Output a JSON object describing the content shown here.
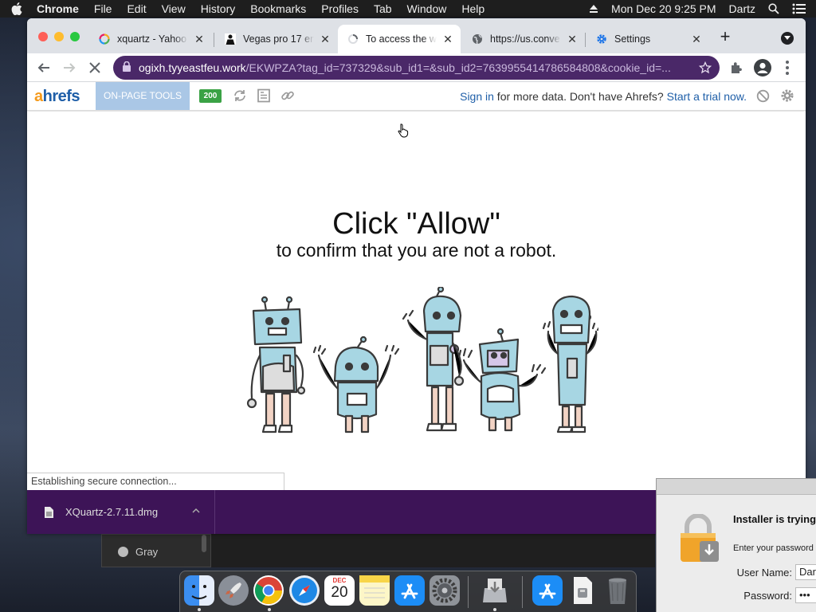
{
  "menubar": {
    "app_name": "Chrome",
    "items": [
      "File",
      "Edit",
      "View",
      "History",
      "Bookmarks",
      "Profiles",
      "Tab",
      "Window",
      "Help"
    ],
    "datetime": "Mon Dec 20  9:25 PM",
    "user": "Dartz"
  },
  "browser": {
    "tabs": [
      {
        "title": "xquartz - Yahoo Search",
        "icon": "yahoo-spinner-icon"
      },
      {
        "title": "Vegas pro 17 en",
        "icon": "person-icon"
      },
      {
        "title": "To access the w",
        "icon": "loading-icon",
        "active": true
      },
      {
        "title": "https://us.conve",
        "icon": "globe-icon"
      },
      {
        "title": "Settings",
        "icon": "gear-icon"
      }
    ],
    "url_host": "ogixh.tyyeastfeu.work",
    "url_path": "/EKWPZA?tag_id=737329&sub_id1=&sub_id2=7639955414786584808&cookie_id=..."
  },
  "ahrefs_bar": {
    "logo_a": "a",
    "logo_rest": "hrefs",
    "onpage_label": "ON-PAGE TOOLS",
    "status_code": "200",
    "sign_in": "Sign in",
    "message_middle": " for more data. Don't have Ahrefs? ",
    "trial_link": "Start a trial now."
  },
  "page": {
    "headline": "Click \"Allow\"",
    "subline": "to confirm that you are not a robot."
  },
  "status_bar": {
    "text": "Establishing secure connection..."
  },
  "downloads": {
    "file": "XQuartz-2.7.11.dmg"
  },
  "background_window": {
    "item": "Gray"
  },
  "installer_dialog": {
    "heading": "Installer is trying",
    "prompt": "Enter your password",
    "username_label": "User Name:",
    "username_value": "Dar",
    "password_label": "Password:",
    "password_value": "•••"
  },
  "dock": {
    "apps": [
      "finder",
      "launchpad",
      "chrome",
      "safari",
      "calendar",
      "notes",
      "app-store",
      "system-preferences",
      "installer",
      "app-store-2",
      "preview",
      "trash"
    ],
    "calendar_month": "DEC",
    "calendar_day": "20"
  }
}
